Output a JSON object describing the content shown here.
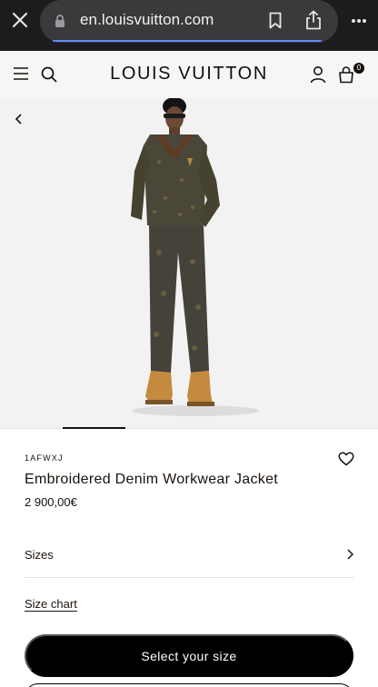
{
  "browser": {
    "url": "en.louisvuitton.com",
    "icons": [
      "close-icon",
      "lock-icon",
      "bookmark-icon",
      "share-icon",
      "more-icon"
    ]
  },
  "header": {
    "brand": "LOUIS VUITTON",
    "bag_count": "0",
    "icons": [
      "menu-icon",
      "search-icon",
      "account-icon",
      "bag-icon"
    ]
  },
  "product": {
    "sku": "1AFWXJ",
    "name": "Embroidered Denim Workwear Jacket",
    "price": "2 900,00€",
    "sizes_label": "Sizes",
    "size_chart_label": "Size chart",
    "select_size_label": "Select your size"
  },
  "colors": {
    "primary": "#19110b",
    "button": "#000000",
    "header_bg": "#f6f6f6",
    "gallery_bg": "#f2f2f2",
    "browser_chrome": "#1c1c1e",
    "load_bar": "#5b8cff"
  }
}
